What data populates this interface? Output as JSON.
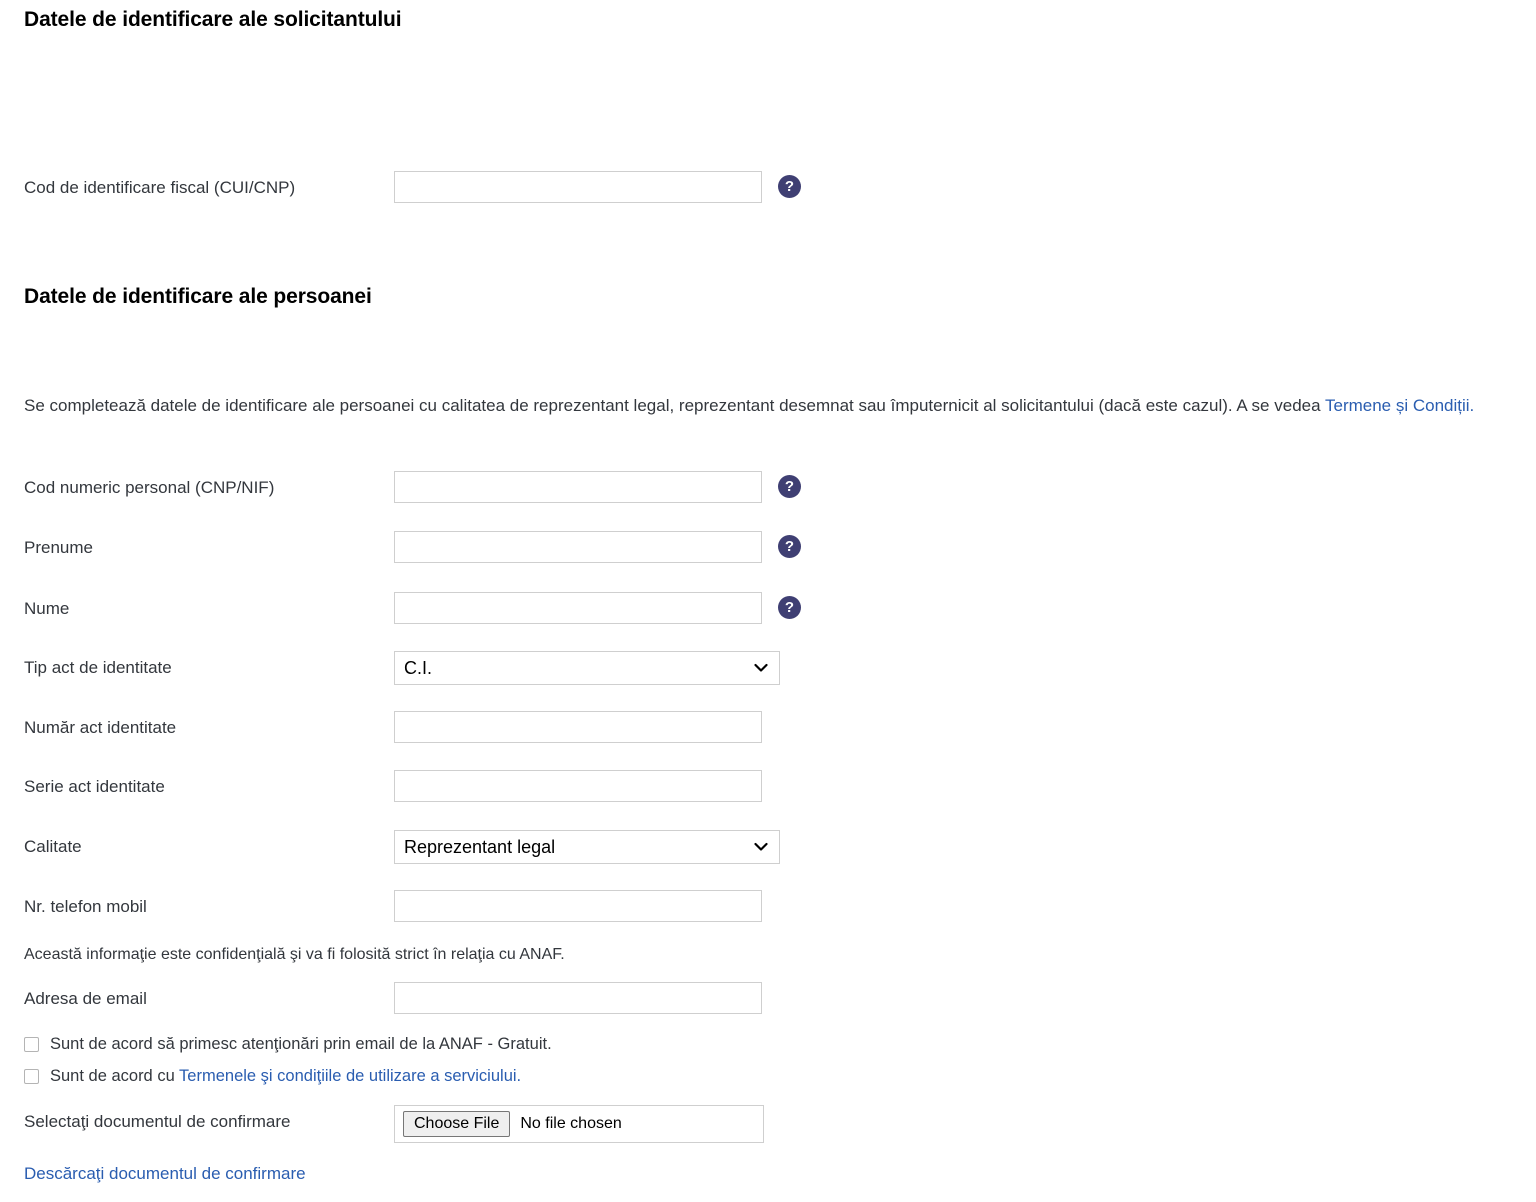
{
  "sections": {
    "applicant": {
      "heading": "Datele de identificare ale solicitantului",
      "fields": [
        {
          "label": "Cod de identificare fiscal (CUI/CNP)",
          "value": "",
          "help_icon": "help-question-icon",
          "help_glyph": "?"
        }
      ]
    },
    "person": {
      "heading": "Datele de identificare ale persoanei",
      "intro_text_before_link": "Se completează datele de identificare ale persoanei cu calitatea de reprezentant legal, reprezentant desemnat sau împuternicit al solicitantului (dacă este cazul). A se vedea ",
      "intro_link_text": "Termene și Condiții.",
      "fields": {
        "cnp": {
          "label": "Cod numeric personal (CNP/NIF)",
          "value": "",
          "help_glyph": "?"
        },
        "prenume": {
          "label": "Prenume",
          "value": "",
          "help_glyph": "?"
        },
        "nume": {
          "label": "Nume",
          "value": "",
          "help_glyph": "?"
        },
        "tip_act": {
          "label": "Tip act de identitate",
          "value": "C.I."
        },
        "numar_act": {
          "label": "Număr act identitate",
          "value": ""
        },
        "serie_act": {
          "label": "Serie act identitate",
          "value": ""
        },
        "calitate": {
          "label": "Calitate",
          "value": "Reprezentant legal"
        },
        "telefon": {
          "label": "Nr. telefon mobil",
          "value": ""
        },
        "email": {
          "label": "Adresa de email",
          "value": ""
        }
      },
      "confidential_note": "Această informaţie este confidenţială şi va fi folosită strict în relaţia cu ANAF.",
      "checkboxes": {
        "notifications": {
          "label": "Sunt de acord să primesc atenţionări prin email de la ANAF - Gratuit.",
          "checked": false
        },
        "terms": {
          "label_before_link": "Sunt de acord cu ",
          "link_text": "Termenele şi condiţiile de utilizare a serviciului.",
          "checked": false
        }
      },
      "file_upload": {
        "label": "Selectaţi documentul de confirmare",
        "button_label": "Choose File",
        "status": "No file chosen"
      },
      "download_link": "Descărcaţi documentul de confirmare"
    }
  },
  "colors": {
    "link": "#2a5db0",
    "help_icon_bg": "#3f3f73",
    "label_text": "#33373d",
    "heading_text": "#000000",
    "input_border": "#cfcfcf"
  }
}
